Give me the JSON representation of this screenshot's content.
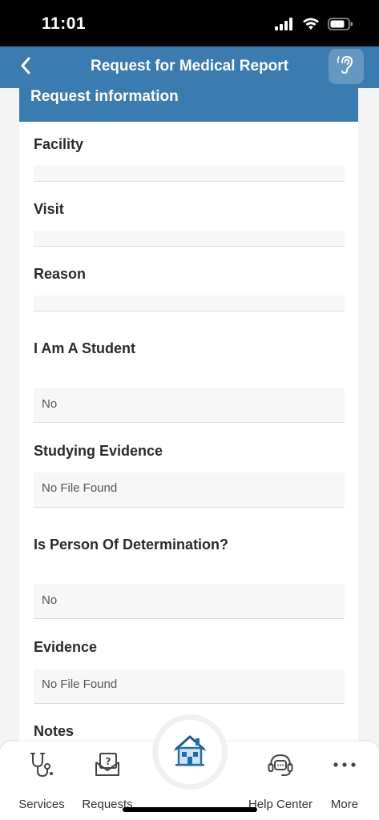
{
  "status_bar": {
    "time": "11:01"
  },
  "header": {
    "title": "Request for Medical Report",
    "back_icon": "chevron-left-icon",
    "accessibility_icon": "ear-icon"
  },
  "section": {
    "title": "Request information"
  },
  "fields": {
    "facility": {
      "label": "Facility",
      "value": ""
    },
    "visit": {
      "label": "Visit",
      "value": ""
    },
    "reason": {
      "label": "Reason",
      "value": ""
    },
    "student": {
      "label": "I Am A Student",
      "value": "No"
    },
    "studying_evidence": {
      "label": "Studying Evidence",
      "value": "No File Found"
    },
    "person_of_determination": {
      "label": "Is Person Of Determination?",
      "value": "No"
    },
    "evidence": {
      "label": "Evidence",
      "value": "No File Found"
    },
    "notes": {
      "label": "Notes"
    }
  },
  "bottom_nav": {
    "services": "Services",
    "requests": "Requests",
    "help_center": "Help Center",
    "more": "More"
  },
  "colors": {
    "primary": "#3a7bb0",
    "home_icon": "#1b6fb0"
  }
}
